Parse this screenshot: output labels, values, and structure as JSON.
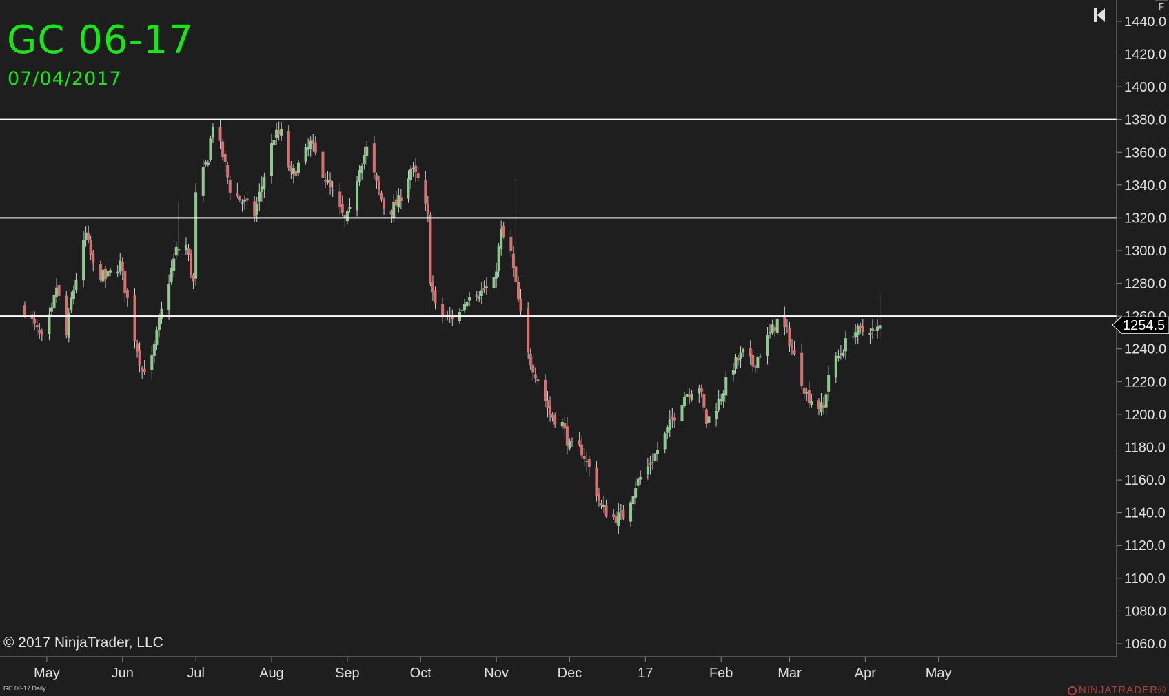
{
  "header": {
    "title": "GC 06-17",
    "date": "07/04/2017"
  },
  "footer": {
    "copyright": "© 2017 NinjaTrader, LLC",
    "chart_label": "GC 06-17 Daily",
    "brand": "NINJATRADER®"
  },
  "controls": {
    "f_label": "F"
  },
  "colors": {
    "background": "#1e1e1e",
    "title_green": "#19e619",
    "up_candle": "#8fc98f",
    "down_candle": "#d97070",
    "wick": "#cfcfcf",
    "horizontal_line": "#ffffff",
    "axis_text": "#e0e0e0"
  },
  "chart_data": {
    "type": "candlestick",
    "title": "GC 06-17",
    "subtitle": "07/04/2017",
    "ylim": [
      1052,
      1453
    ],
    "y_ticks": [
      1060,
      1080,
      1100,
      1120,
      1140,
      1160,
      1180,
      1200,
      1220,
      1240,
      1260,
      1280,
      1300,
      1320,
      1340,
      1360,
      1380,
      1400,
      1420,
      1440
    ],
    "y_tick_labels": [
      "1060.0",
      "1080.0",
      "1100.0",
      "1120.0",
      "1140.0",
      "1160.0",
      "1180.0",
      "1200.0",
      "1220.0",
      "1240.0",
      "1260.0",
      "1280.0",
      "1300.0",
      "1320.0",
      "1340.0",
      "1360.0",
      "1380.0",
      "1400.0",
      "1420.0",
      "1440.0"
    ],
    "x_months": [
      {
        "label": "May",
        "date": "2016-05-01"
      },
      {
        "label": "Jun",
        "date": "2016-06-01"
      },
      {
        "label": "Jul",
        "date": "2016-07-01"
      },
      {
        "label": "Aug",
        "date": "2016-08-01"
      },
      {
        "label": "Sep",
        "date": "2016-09-01"
      },
      {
        "label": "Oct",
        "date": "2016-10-01"
      },
      {
        "label": "Nov",
        "date": "2016-11-01"
      },
      {
        "label": "Dec",
        "date": "2016-12-01"
      },
      {
        "label": "17",
        "date": "2017-01-01"
      },
      {
        "label": "Feb",
        "date": "2017-02-01"
      },
      {
        "label": "Mar",
        "date": "2017-03-01"
      },
      {
        "label": "Apr",
        "date": "2017-04-01"
      },
      {
        "label": "May",
        "date": "2017-05-01"
      }
    ],
    "date_range": [
      "2016-04-22",
      "2017-05-31"
    ],
    "horizontal_lines": [
      1380,
      1320,
      1260
    ],
    "last_price": 1254.5,
    "last_price_label": "1254.5",
    "grid": false,
    "anchors": [
      [
        "2016-04-22",
        1265
      ],
      [
        "2016-04-29",
        1245
      ],
      [
        "2016-05-03",
        1262
      ],
      [
        "2016-05-05",
        1278
      ],
      [
        "2016-05-09",
        1248
      ],
      [
        "2016-05-11",
        1270
      ],
      [
        "2016-05-17",
        1310
      ],
      [
        "2016-05-20",
        1290
      ],
      [
        "2016-05-25",
        1283
      ],
      [
        "2016-05-31",
        1292
      ],
      [
        "2016-06-03",
        1270
      ],
      [
        "2016-06-06",
        1247
      ],
      [
        "2016-06-09",
        1227
      ],
      [
        "2016-06-13",
        1233
      ],
      [
        "2016-06-16",
        1256
      ],
      [
        "2016-06-20",
        1282
      ],
      [
        "2016-06-23",
        1300
      ],
      [
        "2016-06-27",
        1303
      ],
      [
        "2016-06-30",
        1280
      ],
      [
        "2016-07-01",
        1333
      ],
      [
        "2016-07-06",
        1357
      ],
      [
        "2016-07-08",
        1378
      ],
      [
        "2016-07-12",
        1358
      ],
      [
        "2016-07-15",
        1338
      ],
      [
        "2016-07-20",
        1330
      ],
      [
        "2016-07-25",
        1322
      ],
      [
        "2016-07-28",
        1340
      ],
      [
        "2016-08-02",
        1370
      ],
      [
        "2016-08-05",
        1371
      ],
      [
        "2016-08-09",
        1345
      ],
      [
        "2016-08-12",
        1352
      ],
      [
        "2016-08-17",
        1365
      ],
      [
        "2016-08-22",
        1348
      ],
      [
        "2016-08-25",
        1337
      ],
      [
        "2016-08-31",
        1318
      ],
      [
        "2016-09-02",
        1323
      ],
      [
        "2016-09-06",
        1352
      ],
      [
        "2016-09-09",
        1362
      ],
      [
        "2016-09-13",
        1340
      ],
      [
        "2016-09-16",
        1327
      ],
      [
        "2016-09-19",
        1325
      ],
      [
        "2016-09-22",
        1330
      ],
      [
        "2016-09-27",
        1350
      ],
      [
        "2016-09-30",
        1343
      ],
      [
        "2016-10-04",
        1320
      ],
      [
        "2016-10-05",
        1283
      ],
      [
        "2016-10-07",
        1265
      ],
      [
        "2016-10-12",
        1258
      ],
      [
        "2016-10-17",
        1262
      ],
      [
        "2016-10-21",
        1275
      ],
      [
        "2016-10-26",
        1275
      ],
      [
        "2016-10-31",
        1280
      ],
      [
        "2016-11-03",
        1311
      ],
      [
        "2016-11-07",
        1298
      ],
      [
        "2016-11-09",
        1278
      ],
      [
        "2016-11-11",
        1260
      ],
      [
        "2016-11-14",
        1236
      ],
      [
        "2016-11-18",
        1222
      ],
      [
        "2016-11-23",
        1200
      ],
      [
        "2016-11-28",
        1194
      ],
      [
        "2016-12-01",
        1180
      ],
      [
        "2016-12-06",
        1178
      ],
      [
        "2016-12-09",
        1167
      ],
      [
        "2016-12-14",
        1143
      ],
      [
        "2016-12-19",
        1137
      ],
      [
        "2016-12-23",
        1138
      ],
      [
        "2016-12-28",
        1157
      ],
      [
        "2017-01-03",
        1170
      ],
      [
        "2017-01-09",
        1187
      ],
      [
        "2017-01-13",
        1200
      ],
      [
        "2017-01-17",
        1212
      ],
      [
        "2017-01-23",
        1218
      ],
      [
        "2017-01-26",
        1195
      ],
      [
        "2017-01-31",
        1208
      ],
      [
        "2017-02-06",
        1230
      ],
      [
        "2017-02-10",
        1237
      ],
      [
        "2017-02-14",
        1230
      ],
      [
        "2017-02-17",
        1238
      ],
      [
        "2017-02-24",
        1257
      ],
      [
        "2017-02-28",
        1250
      ],
      [
        "2017-03-03",
        1235
      ],
      [
        "2017-03-08",
        1212
      ],
      [
        "2017-03-13",
        1205
      ],
      [
        "2017-03-15",
        1203
      ],
      [
        "2017-03-17",
        1225
      ],
      [
        "2017-03-22",
        1238
      ],
      [
        "2017-03-27",
        1251
      ],
      [
        "2017-03-30",
        1250
      ],
      [
        "2017-04-03",
        1253
      ],
      [
        "2017-04-05",
        1249
      ],
      [
        "2017-04-07",
        1254.5
      ]
    ]
  }
}
